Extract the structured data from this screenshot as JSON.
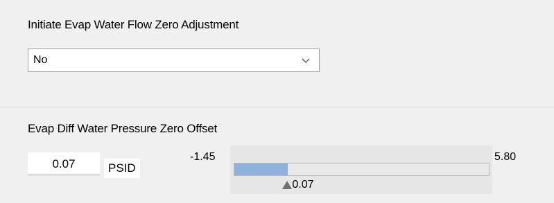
{
  "zero_adjust": {
    "label": "Initiate Evap Water Flow Zero Adjustment",
    "selected": "No"
  },
  "pressure_offset": {
    "label": "Evap Diff Water Pressure Zero Offset",
    "value": "0.07",
    "unit": "PSID",
    "slider": {
      "min_label": "-1.45",
      "max_label": "5.80",
      "current_label": "0.07",
      "min": -1.45,
      "max": 5.8,
      "current": 0.07
    }
  },
  "colors": {
    "slider_fill": "#8fb1db",
    "background": "#f0f0f0"
  },
  "icons": {
    "dropdown": "chevron-down-icon",
    "thumb": "triangle-up-icon"
  }
}
